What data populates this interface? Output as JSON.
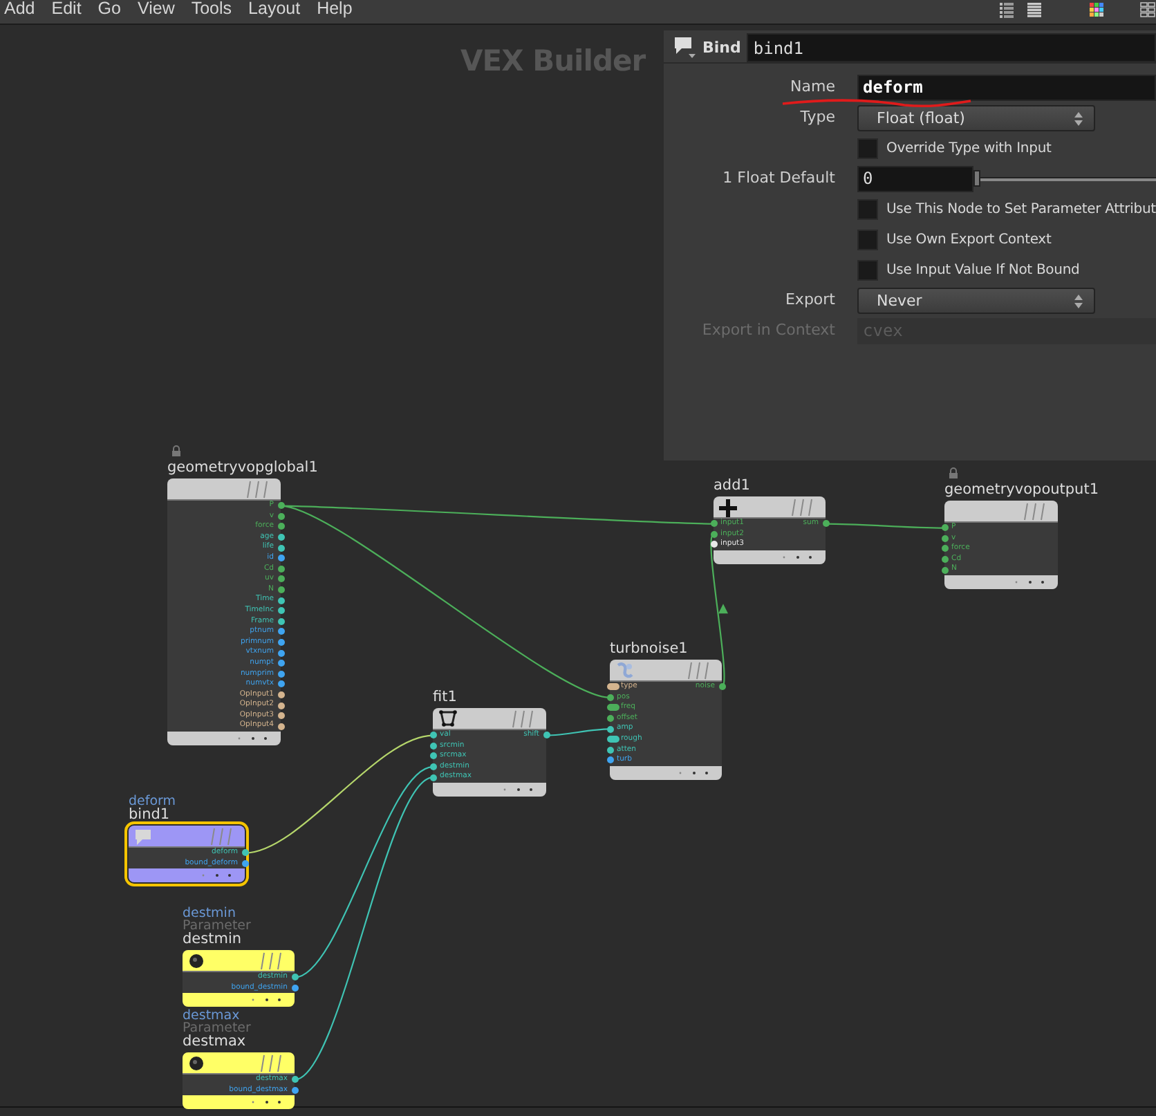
{
  "menu_bar": {
    "items": [
      "Add",
      "Edit",
      "Go",
      "View",
      "Tools",
      "Layout",
      "Help"
    ]
  },
  "network_title": "VEX Builder",
  "parameters": {
    "node_type": "Bind",
    "node_name": "bind1",
    "rows": [
      {
        "kind": "text",
        "label": "Name",
        "value": "deform",
        "disabled": false
      },
      {
        "kind": "dropdown",
        "label": "Type",
        "value": "Float (float)",
        "disabled": false
      },
      {
        "kind": "checkbox",
        "text": "Override Type with Input",
        "checked": false,
        "disabled": false
      },
      {
        "kind": "slider",
        "label": "1 Float Default",
        "value": "0",
        "level": 0,
        "disabled": false
      },
      {
        "kind": "checkbox",
        "text": "Use This Node to Set Parameter Attribut",
        "checked": false,
        "disabled": false
      },
      {
        "kind": "checkbox",
        "text": "Use Own Export Context",
        "checked": false,
        "disabled": false
      },
      {
        "kind": "checkbox",
        "text": "Use Input Value If Not Bound",
        "checked": false,
        "disabled": false
      },
      {
        "kind": "dropdown",
        "label": "Export",
        "value": "Never",
        "disabled": false
      },
      {
        "kind": "text",
        "label": "Export in Context",
        "value": "cvex",
        "disabled": true
      }
    ]
  },
  "nodes": [
    {
      "kind": "global",
      "name": "geometryvopglobal1",
      "locked": true,
      "selected": false,
      "color": "#cccccc",
      "outputs": [
        {
          "label": "P",
          "color": "#4caf5a"
        },
        {
          "label": "v",
          "color": "#4caf5a"
        },
        {
          "label": "force",
          "color": "#4caf5a"
        },
        {
          "label": "age",
          "color": "#3fc4b4"
        },
        {
          "label": "life",
          "color": "#3fc4b4"
        },
        {
          "label": "id",
          "color": "#3fa4f0"
        },
        {
          "label": "Cd",
          "color": "#4caf5a"
        },
        {
          "label": "uv",
          "color": "#4caf5a"
        },
        {
          "label": "N",
          "color": "#4caf5a"
        },
        {
          "label": "Time",
          "color": "#3fc4b4"
        },
        {
          "label": "TimeInc",
          "color": "#3fc4b4"
        },
        {
          "label": "Frame",
          "color": "#3fc4b4"
        },
        {
          "label": "ptnum",
          "color": "#3fa4f0"
        },
        {
          "label": "primnum",
          "color": "#3fa4f0"
        },
        {
          "label": "vtxnum",
          "color": "#3fa4f0"
        },
        {
          "label": "numpt",
          "color": "#3fa4f0"
        },
        {
          "label": "numprim",
          "color": "#3fa4f0"
        },
        {
          "label": "numvtx",
          "color": "#3fa4f0"
        },
        {
          "label": "OpInput1",
          "color": "#d4b48e"
        },
        {
          "label": "OpInput2",
          "color": "#d4b48e"
        },
        {
          "label": "OpInput3",
          "color": "#d4b48e"
        },
        {
          "label": "OpInput4",
          "color": "#d4b48e"
        }
      ]
    },
    {
      "kind": "add",
      "name": "add1",
      "locked": false,
      "selected": false,
      "color": "#cccccc",
      "inputs": [
        {
          "label": "input1",
          "color": "#4caf5a"
        },
        {
          "label": "input2",
          "color": "#4caf5a"
        },
        {
          "label": "input3",
          "color": "#e8e8e8"
        }
      ],
      "outputs": [
        {
          "label": "sum",
          "color": "#4caf5a"
        }
      ]
    },
    {
      "kind": "output",
      "name": "geometryvopoutput1",
      "locked": true,
      "selected": false,
      "color": "#cccccc",
      "inputs": [
        {
          "label": "P",
          "color": "#4caf5a"
        },
        {
          "label": "v",
          "color": "#4caf5a"
        },
        {
          "label": "force",
          "color": "#4caf5a"
        },
        {
          "label": "Cd",
          "color": "#4caf5a"
        },
        {
          "label": "N",
          "color": "#4caf5a"
        }
      ]
    },
    {
      "kind": "noise",
      "name": "turbnoise1",
      "locked": false,
      "selected": false,
      "color": "#cccccc",
      "inputs": [
        {
          "label": "type",
          "color": "#d4b48e",
          "kind": "pill"
        },
        {
          "label": "pos",
          "color": "#4caf5a",
          "kind": "dot"
        },
        {
          "label": "freq",
          "color": "#4caf5a",
          "kind": "pill"
        },
        {
          "label": "offset",
          "color": "#4caf5a",
          "kind": "dot"
        },
        {
          "label": "amp",
          "color": "#3fc4b4",
          "kind": "dot"
        },
        {
          "label": "rough",
          "color": "#3fc4b4",
          "kind": "pill"
        },
        {
          "label": "atten",
          "color": "#3fc4b4",
          "kind": "dot"
        },
        {
          "label": "turb",
          "color": "#3fa4f0",
          "kind": "dot"
        }
      ],
      "outputs": [
        {
          "label": "noise",
          "color": "#4caf5a"
        }
      ]
    },
    {
      "kind": "fit",
      "name": "fit1",
      "locked": false,
      "selected": false,
      "color": "#cccccc",
      "inputs": [
        {
          "label": "val",
          "color": "#3fc4b4"
        },
        {
          "label": "srcmin",
          "color": "#3fc4b4"
        },
        {
          "label": "srcmax",
          "color": "#3fc4b4"
        },
        {
          "label": "destmin",
          "color": "#3fc4b4"
        },
        {
          "label": "destmax",
          "color": "#3fc4b4"
        }
      ],
      "outputs": [
        {
          "label": "shift",
          "color": "#3fc4b4"
        }
      ]
    },
    {
      "kind": "bind",
      "name": "bind1",
      "locked": false,
      "selected": true,
      "color": "#9d96f5",
      "tags": [
        {
          "text": "deform",
          "kind": "parm"
        }
      ],
      "outputs": [
        {
          "label": "deform",
          "color": "#3fc4b4"
        },
        {
          "label": "bound_deform",
          "color": "#3fa4f0"
        }
      ]
    },
    {
      "kind": "parameter",
      "name": "destmin",
      "locked": false,
      "selected": false,
      "color": "#ffff66",
      "tags": [
        {
          "text": "destmin",
          "kind": "parm"
        },
        {
          "text": "Parameter",
          "kind": "type"
        }
      ],
      "outputs": [
        {
          "label": "destmin",
          "color": "#3fc4b4"
        },
        {
          "label": "bound_destmin",
          "color": "#3fa4f0"
        }
      ]
    },
    {
      "kind": "parameter",
      "name": "destmax",
      "locked": false,
      "selected": false,
      "color": "#ffff66",
      "tags": [
        {
          "text": "destmax",
          "kind": "parm"
        },
        {
          "text": "Parameter",
          "kind": "type"
        }
      ],
      "outputs": [
        {
          "label": "destmax",
          "color": "#3fc4b4"
        },
        {
          "label": "bound_destmax",
          "color": "#3fa4f0"
        }
      ]
    }
  ]
}
